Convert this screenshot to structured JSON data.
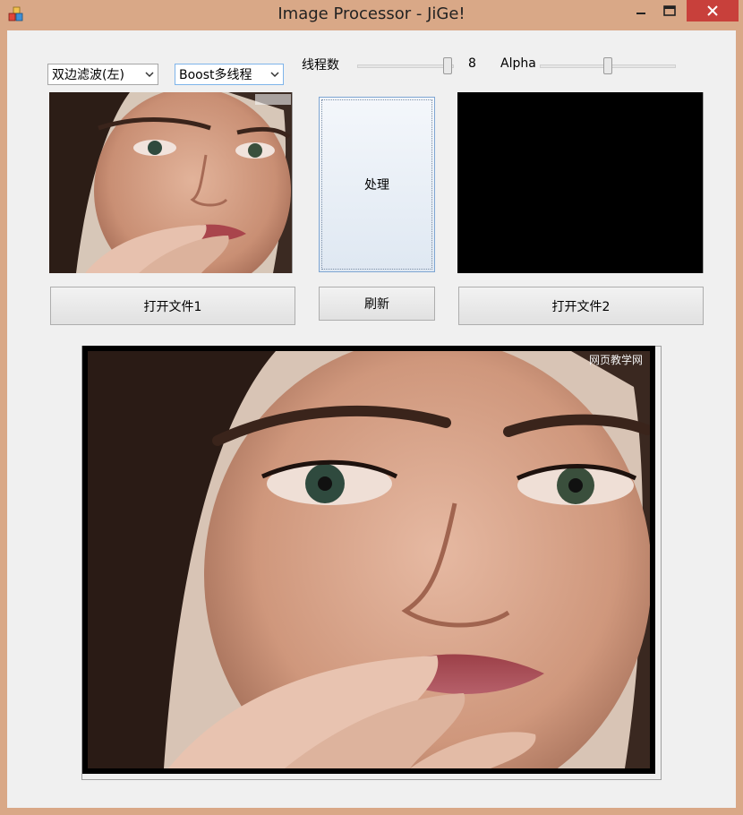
{
  "window": {
    "title": "Image Processor - JiGe!",
    "frame_color": "#d9a887",
    "close_color": "#c8403b"
  },
  "filter_combo": {
    "value": "双边滤波(左)"
  },
  "thread_mode_combo": {
    "value": "Boost多线程"
  },
  "thread_slider": {
    "label": "线程数",
    "value": "8",
    "level": 1.0
  },
  "alpha_slider": {
    "label": "Alpha",
    "level": 0.5
  },
  "buttons": {
    "process": "处理",
    "open_file1": "打开文件1",
    "refresh": "刷新",
    "open_file2": "打开文件2"
  },
  "watermark": "网页教学网",
  "icons": [
    "app-icon",
    "minimize-icon",
    "maximize-icon",
    "close-icon",
    "chevron-down-icon"
  ]
}
